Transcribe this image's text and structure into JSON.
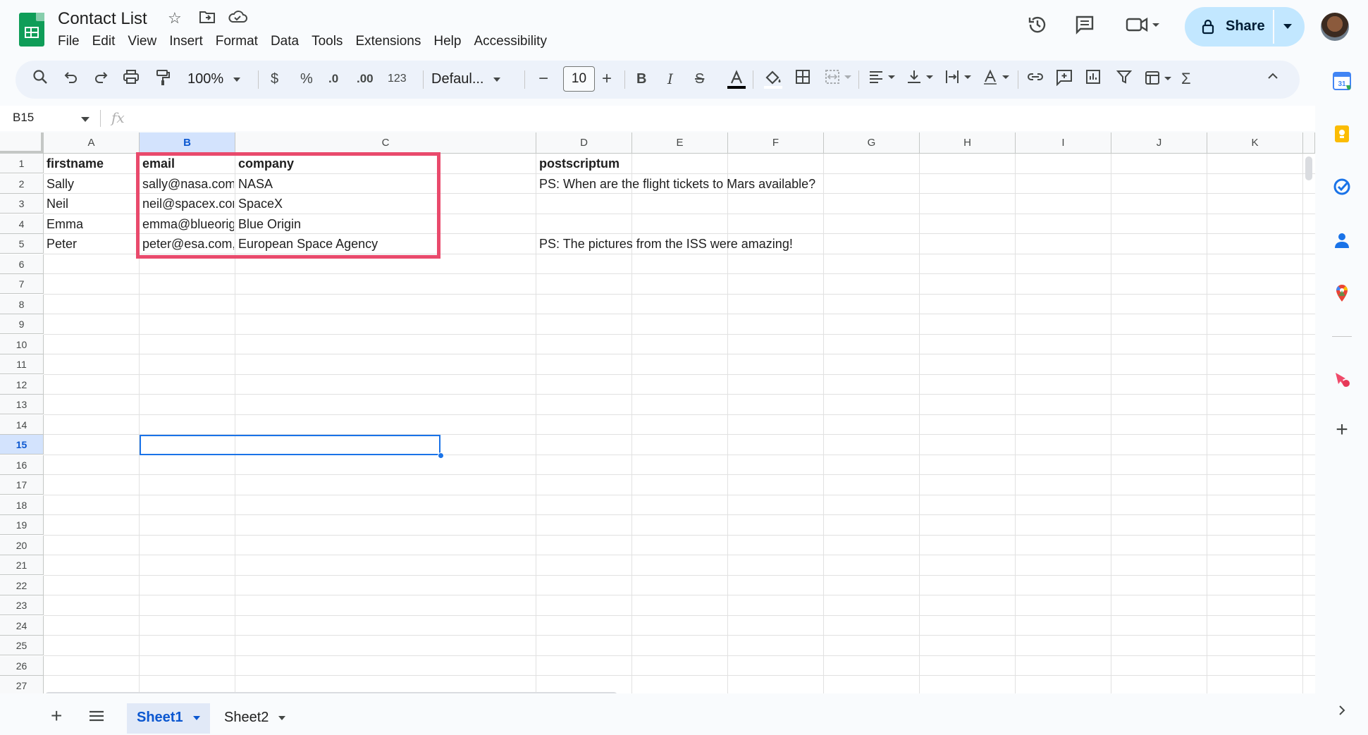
{
  "header": {
    "doc_title": "Contact List",
    "menu": [
      "File",
      "Edit",
      "View",
      "Insert",
      "Format",
      "Data",
      "Tools",
      "Extensions",
      "Help",
      "Accessibility"
    ],
    "share_label": "Share"
  },
  "toolbar": {
    "zoom": "100%",
    "currency": "$",
    "percent": "%",
    "decrease_decimal": ".0",
    "increase_decimal": ".00",
    "number_format": "123",
    "font": "Defaul...",
    "font_size": "10"
  },
  "formula_bar": {
    "name_box": "B15",
    "fx": "fx",
    "value": ""
  },
  "grid": {
    "columns": [
      "A",
      "B",
      "C",
      "D",
      "E",
      "F",
      "G",
      "H",
      "I",
      "J",
      "K"
    ],
    "rows": [
      "1",
      "2",
      "3",
      "4",
      "5",
      "6",
      "7",
      "8",
      "9",
      "10",
      "11",
      "12",
      "13",
      "14",
      "15",
      "16",
      "17",
      "18",
      "19",
      "20",
      "21",
      "22",
      "23",
      "24",
      "25",
      "26",
      "27"
    ],
    "selected_column": "B",
    "selected_row": "15",
    "cells": {
      "A1": "firstname",
      "B1": "email",
      "C1": "company",
      "D1": "postscriptum",
      "A2": "Sally",
      "B2": "sally@nasa.com, enzo@nasa.com, max@nasa.com",
      "C2": "NASA",
      "D2": "PS: When are the flight tickets to Mars available?",
      "A3": "Neil",
      "B3": "neil@spacex.com",
      "C3": "SpaceX",
      "A4": "Emma",
      "B4": "emma@blueorigin.com",
      "C4": "Blue Origin",
      "A5": "Peter",
      "B5": "peter@esa.com, sarah@esa.com",
      "C5": "European Space Agency",
      "D5": "PS: The pictures from the ISS were amazing!"
    }
  },
  "sheets": {
    "tabs": [
      "Sheet1",
      "Sheet2"
    ],
    "active": "Sheet1"
  },
  "colors": {
    "highlight": "#e94a6c",
    "selection": "#1a73e8",
    "share_bg": "#c2e7ff"
  }
}
